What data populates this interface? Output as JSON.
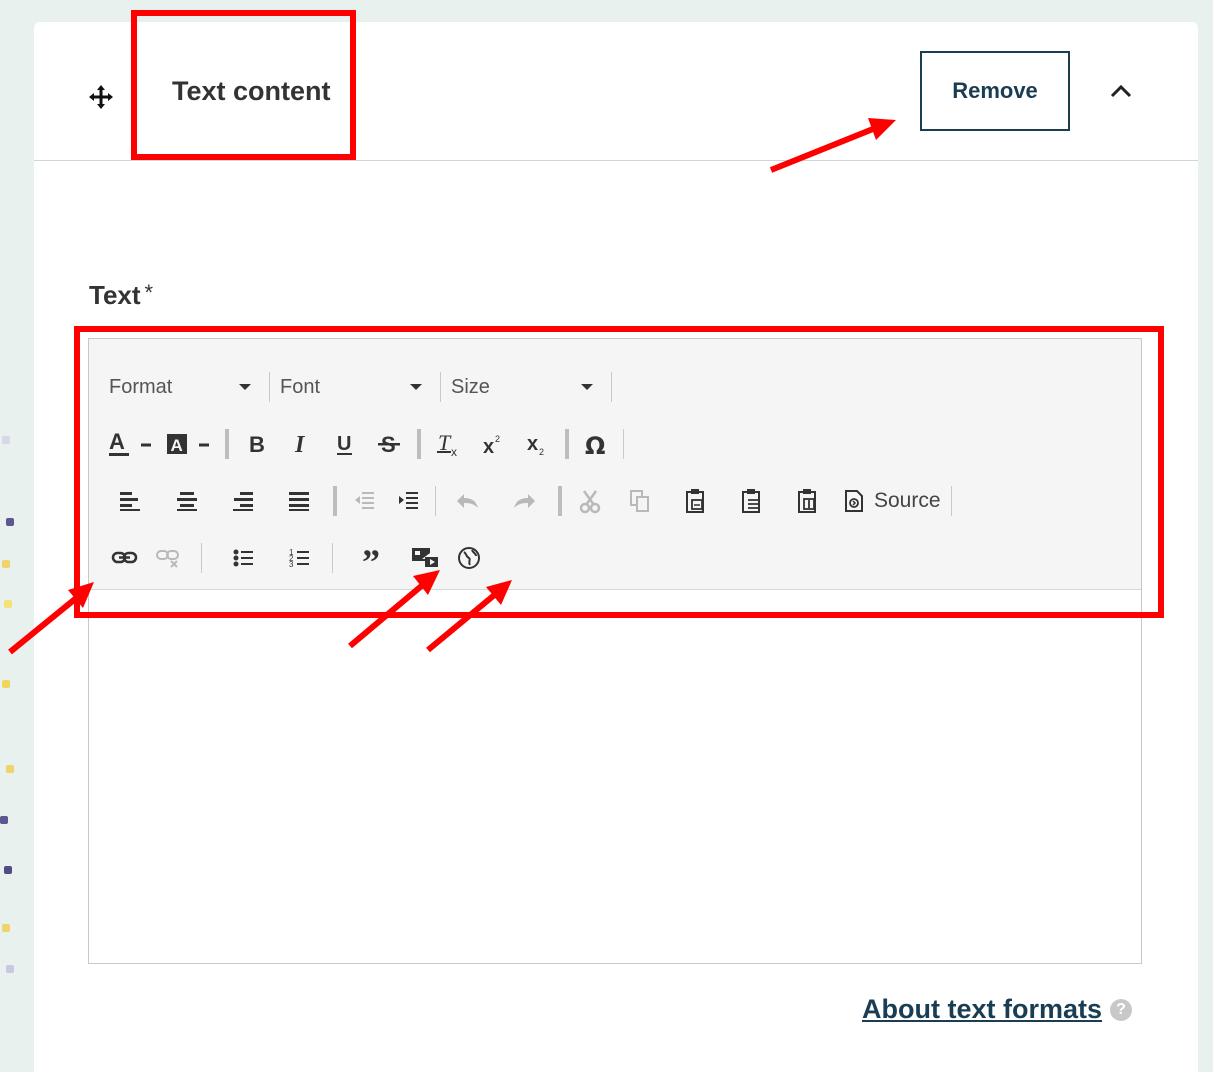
{
  "panel": {
    "title": "Text content",
    "remove_label": "Remove"
  },
  "field": {
    "label": "Text",
    "required_mark": "*"
  },
  "toolbar": {
    "format_label": "Format",
    "font_label": "Font",
    "size_label": "Size",
    "source_label": "Source",
    "row2_icons": [
      "text-color-icon",
      "background-color-icon",
      "bold-icon",
      "italic-icon",
      "underline-icon",
      "strikethrough-icon",
      "remove-format-icon",
      "superscript-icon",
      "subscript-icon",
      "special-char-icon"
    ],
    "row3_icons": [
      "align-left-icon",
      "align-center-icon",
      "align-right-icon",
      "justify-icon",
      "outdent-icon",
      "indent-icon",
      "undo-icon",
      "redo-icon",
      "cut-icon",
      "copy-icon",
      "paste-icon",
      "paste-text-icon",
      "paste-word-icon",
      "source-icon"
    ],
    "row4_icons": [
      "link-icon",
      "unlink-icon",
      "bulleted-list-icon",
      "numbered-list-icon",
      "blockquote-icon",
      "media-embed-icon",
      "language-icon"
    ]
  },
  "help": {
    "link_label": "About text formats",
    "icon_char": "?"
  },
  "colors": {
    "annotation": "#ff0000",
    "accent": "#1b3d54",
    "page_background": "#e9f1ef"
  }
}
